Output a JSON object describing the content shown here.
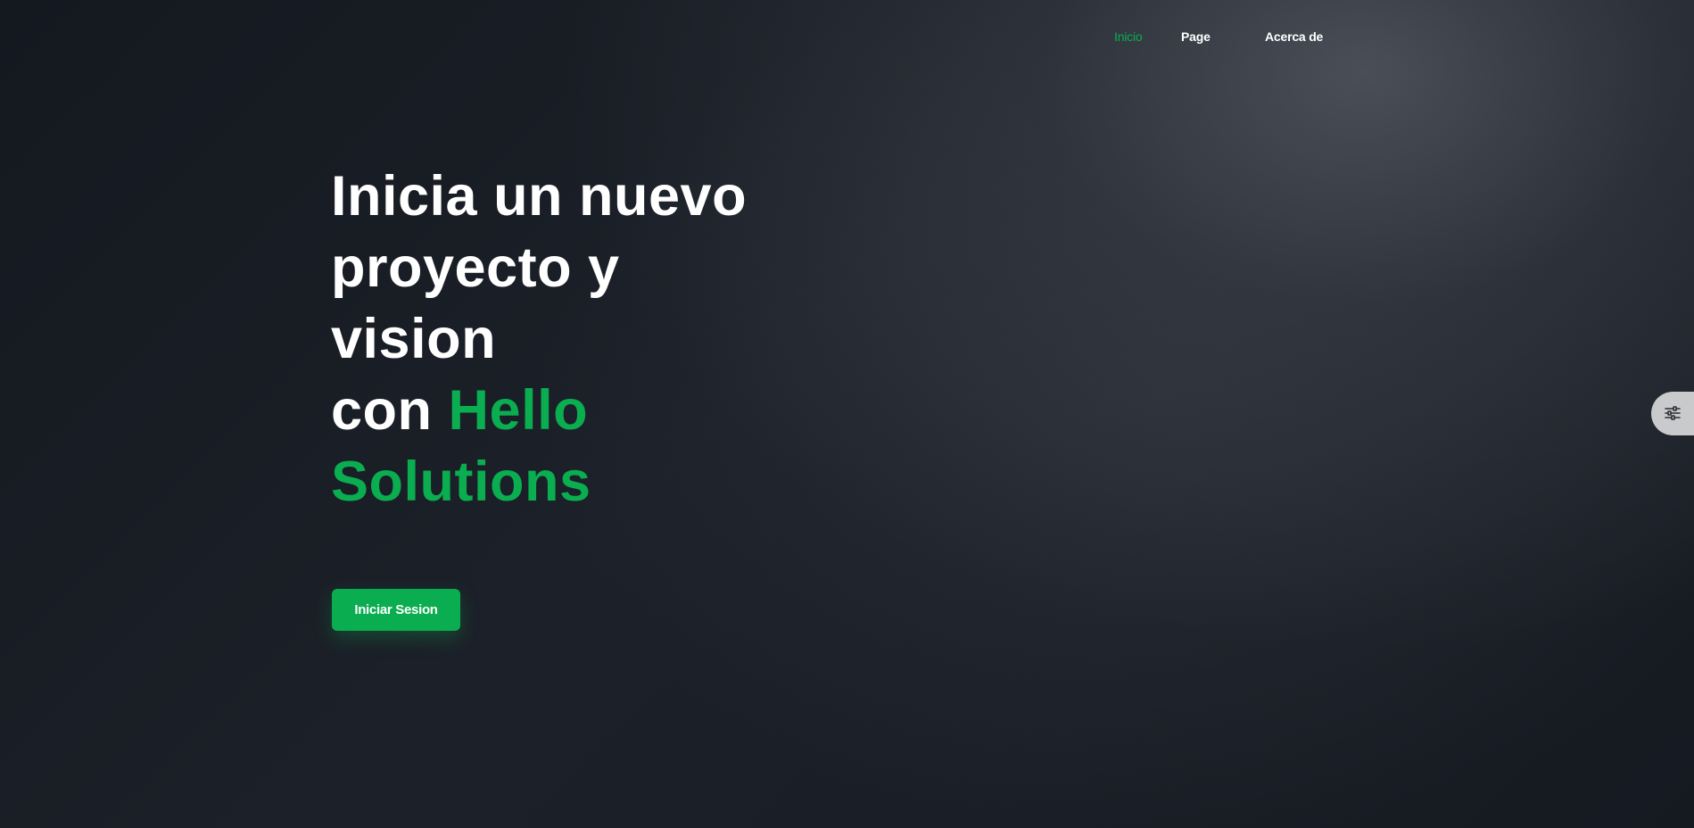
{
  "nav": {
    "items": [
      {
        "label": "Inicio",
        "active": true
      },
      {
        "label": "Page",
        "active": false
      },
      {
        "label": "Acerca de",
        "active": false
      }
    ]
  },
  "hero": {
    "title_line1": "Inicia un nuevo",
    "title_line2": "proyecto y",
    "title_line3": "vision",
    "title_line4_prefix": "con",
    "title_brand_part1": "Hello",
    "title_brand_part2": "Solutions"
  },
  "cta": {
    "label": "Iniciar Sesion"
  },
  "side_panel": {
    "icon": "sliders-icon"
  },
  "colors": {
    "accent": "#0aad50",
    "background": "#161a21",
    "text": "#ffffff",
    "settings_tab": "#c9cacc"
  }
}
